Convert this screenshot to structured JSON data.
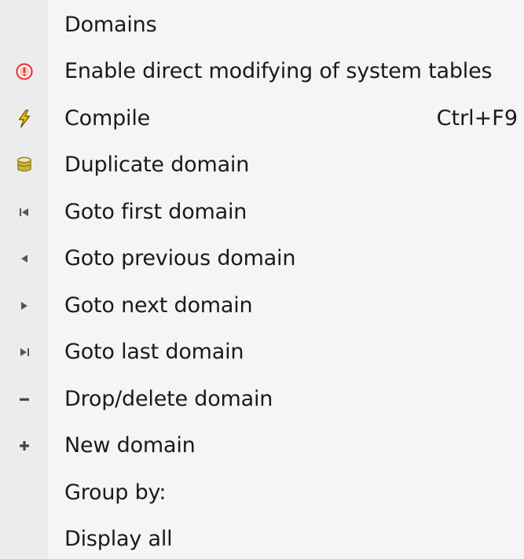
{
  "menu": {
    "items": [
      {
        "label": "Domains",
        "icon": "none",
        "shortcut": ""
      },
      {
        "label": "Enable direct modifying of system tables",
        "icon": "warning-icon",
        "shortcut": ""
      },
      {
        "label": "Compile",
        "icon": "lightning-icon",
        "shortcut": "Ctrl+F9"
      },
      {
        "label": "Duplicate domain",
        "icon": "database-icon",
        "shortcut": ""
      },
      {
        "label": "Goto first domain",
        "icon": "first-icon",
        "shortcut": ""
      },
      {
        "label": "Goto previous domain",
        "icon": "previous-icon",
        "shortcut": ""
      },
      {
        "label": "Goto next domain",
        "icon": "next-icon",
        "shortcut": ""
      },
      {
        "label": "Goto last domain",
        "icon": "last-icon",
        "shortcut": ""
      },
      {
        "label": "Drop/delete domain",
        "icon": "minus-icon",
        "shortcut": ""
      },
      {
        "label": "New domain",
        "icon": "plus-icon",
        "shortcut": ""
      },
      {
        "label": "Group by:",
        "icon": "none",
        "shortcut": ""
      },
      {
        "label": "Display all",
        "icon": "none",
        "shortcut": ""
      }
    ]
  },
  "colors": {
    "gutter": "#ececec",
    "background": "#f5f5f5",
    "warning": "#e53935",
    "lightning": "#f2c200",
    "database": "#c9b53a",
    "nav": "#555555"
  }
}
